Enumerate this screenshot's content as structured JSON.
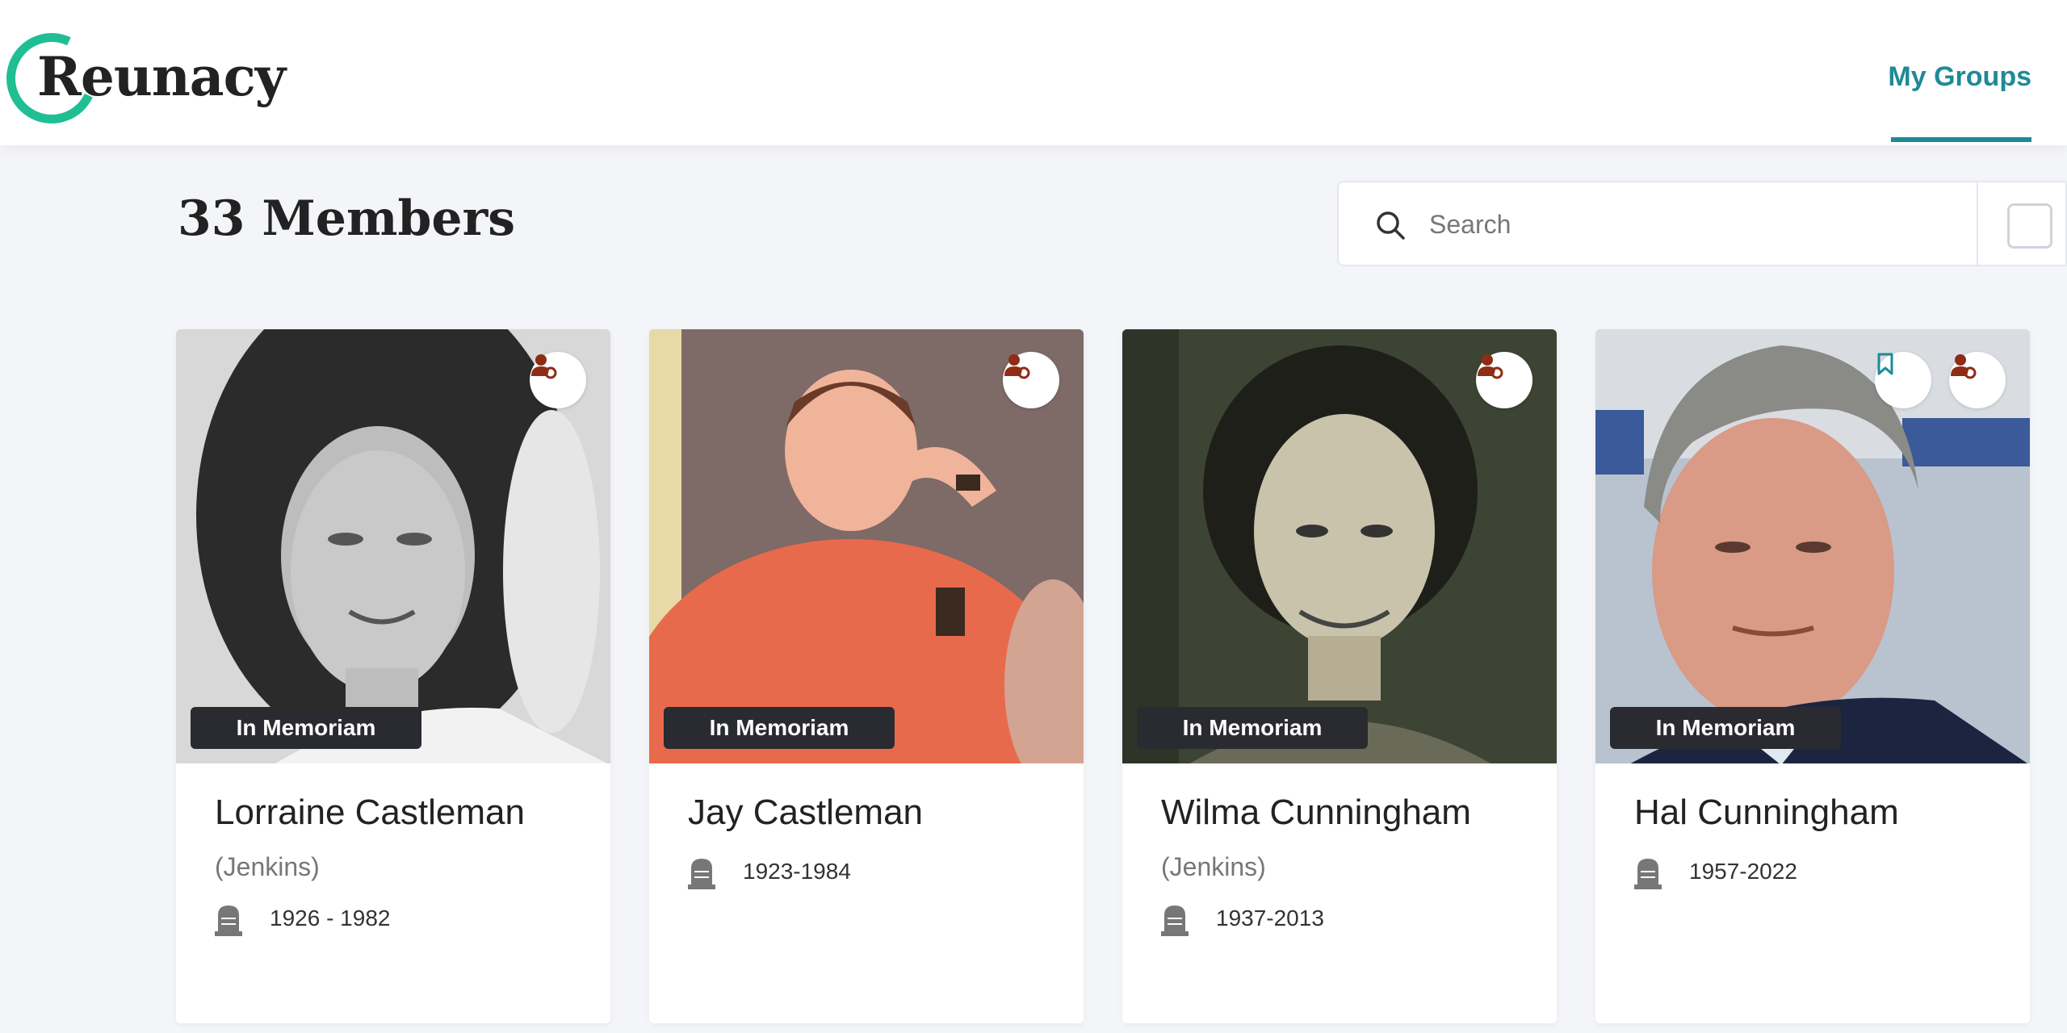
{
  "app": {
    "logo_text": "Reunacy",
    "nav_tab": "My Groups",
    "accent_color": "#1f8a96",
    "logo_color": "#1fbf93"
  },
  "page": {
    "title": "33 Members"
  },
  "search": {
    "placeholder": "Search",
    "value": ""
  },
  "members": [
    {
      "name": "Lorraine Castleman",
      "maiden": "(Jenkins)",
      "dates": "1926 - 1982",
      "badge": "In Memoriam",
      "icons": [
        "admin-user-icon"
      ]
    },
    {
      "name": "Jay Castleman",
      "maiden": "",
      "dates": "1923-1984",
      "badge": "In Memoriam",
      "icons": [
        "admin-user-icon"
      ]
    },
    {
      "name": "Wilma Cunningham",
      "maiden": "(Jenkins)",
      "dates": "1937-2013",
      "badge": "In Memoriam",
      "icons": [
        "admin-user-icon"
      ]
    },
    {
      "name": "Hal Cunningham",
      "maiden": "",
      "dates": "1957-2022",
      "badge": "In Memoriam",
      "icons": [
        "bookmark-icon",
        "admin-user-icon"
      ]
    }
  ]
}
